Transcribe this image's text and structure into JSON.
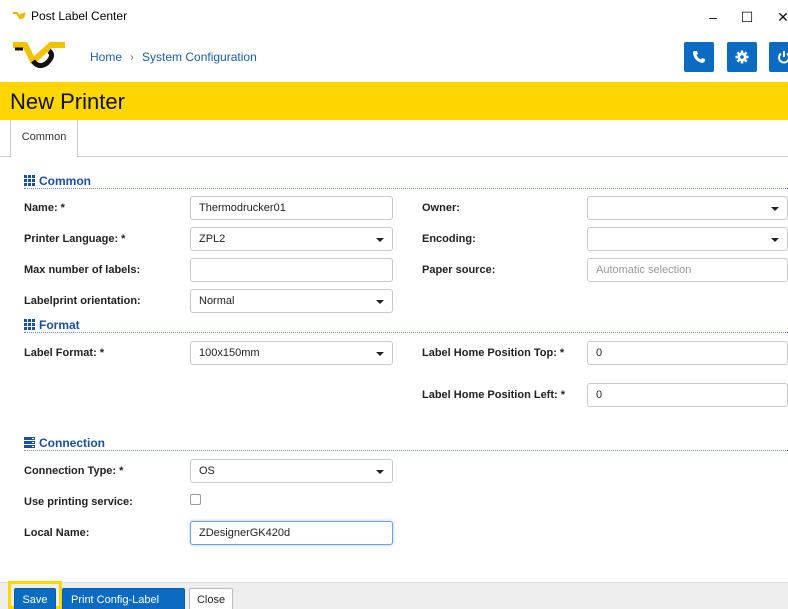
{
  "window": {
    "title": "Post Label Center",
    "minimize": "–",
    "maximize": "☐",
    "close": "✕"
  },
  "breadcrumb": {
    "home": "Home",
    "separator": "›",
    "current": "System Configuration"
  },
  "page": {
    "title": "New Printer"
  },
  "tabs": [
    {
      "label": "Common"
    }
  ],
  "sections": {
    "common": "Common",
    "format": "Format",
    "connection": "Connection"
  },
  "fields": {
    "name": {
      "label": "Name: *",
      "value": "Thermodrucker01"
    },
    "printer_language": {
      "label": "Printer Language: *",
      "value": "ZPL2"
    },
    "max_labels": {
      "label": "Max number of labels:",
      "value": ""
    },
    "orientation": {
      "label": "Labelprint orientation:",
      "value": "Normal"
    },
    "owner": {
      "label": "Owner:",
      "value": ""
    },
    "encoding": {
      "label": "Encoding:",
      "value": ""
    },
    "paper_source": {
      "label": "Paper source:",
      "placeholder": "Automatic selection"
    },
    "label_format": {
      "label": "Label Format: *",
      "value": "100x150mm"
    },
    "home_top": {
      "label": "Label Home Position Top: *",
      "value": "0"
    },
    "home_left": {
      "label": "Label Home Position Left: *",
      "value": "0"
    },
    "connection_type": {
      "label": "Connection Type: *",
      "value": "OS"
    },
    "printing_service": {
      "label": "Use printing service:",
      "checked": false
    },
    "local_name": {
      "label": "Local Name:",
      "value": "ZDesignerGK420d"
    }
  },
  "footer": {
    "save": "Save",
    "print_config": "Print Config-Label",
    "close": "Close"
  },
  "colors": {
    "brand_yellow": "#ffd600",
    "primary_blue": "#0b6bc2",
    "section_blue": "#1a4fa0"
  }
}
